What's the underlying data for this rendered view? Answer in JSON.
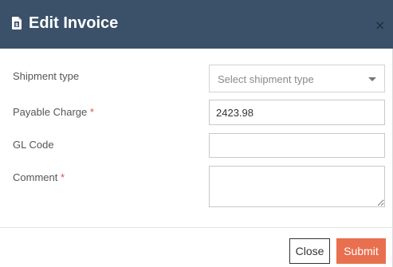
{
  "dialog": {
    "title": "Edit Invoice",
    "icon": "invoice-document-icon",
    "close_glyph": "×"
  },
  "form": {
    "shipment_type": {
      "label": "Shipment type",
      "placeholder": "Select shipment type",
      "required": false
    },
    "payable_charge": {
      "label": "Payable Charge",
      "required_marker": "*",
      "value": "2423.98"
    },
    "gl_code": {
      "label": "GL Code",
      "value": ""
    },
    "comment": {
      "label": "Comment",
      "required_marker": "*",
      "value": ""
    }
  },
  "footer": {
    "close_label": "Close",
    "submit_label": "Submit"
  },
  "colors": {
    "header_bg": "#3a5169",
    "submit_bg": "#e8704f",
    "required": "#d9534f"
  }
}
